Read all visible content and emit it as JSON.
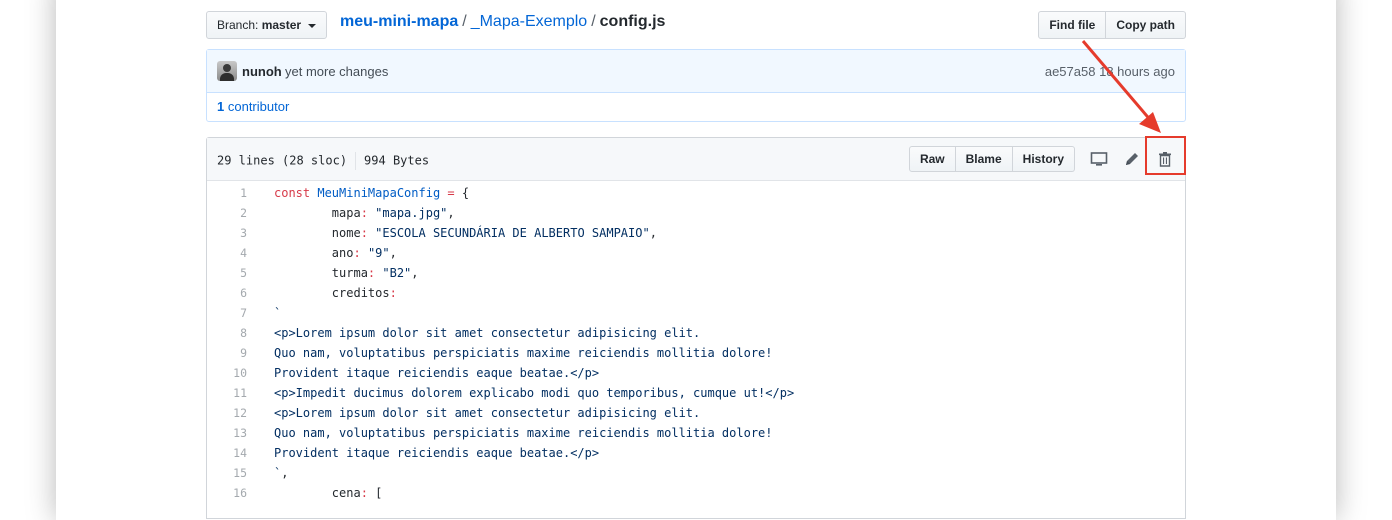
{
  "topbar": {
    "branch_prefix": "Branch:",
    "branch": "master",
    "repo": "meu-mini-mapa",
    "folder": "_Mapa-Exemplo",
    "file": "config.js",
    "find_file": "Find file",
    "copy_path": "Copy path"
  },
  "commit": {
    "author": "nunoh",
    "message": "yet more changes",
    "sha": "ae57a58",
    "time": "18 hours ago",
    "contributors_count": "1",
    "contributors_label": "contributor"
  },
  "file": {
    "lines": "29 lines (28 sloc)",
    "size": "994 Bytes",
    "raw": "Raw",
    "blame": "Blame",
    "history": "History"
  },
  "icons": {
    "desktop": "desktop-icon",
    "edit": "pencil-icon",
    "delete": "trash-icon"
  },
  "colors": {
    "link": "#0366d6",
    "highlight": "#e53b2c"
  },
  "code_lines": [
    {
      "n": "1",
      "parts": [
        [
          "kw",
          "const "
        ],
        [
          "nm",
          "MeuMiniMapaConfig"
        ],
        [
          "kw",
          " = "
        ],
        [
          "pl",
          "{"
        ]
      ]
    },
    {
      "n": "2",
      "parts": [
        [
          "pl",
          "        mapa"
        ],
        [
          "kw",
          ":"
        ],
        [
          "str",
          " \"mapa.jpg\""
        ],
        [
          "pl",
          ","
        ]
      ]
    },
    {
      "n": "3",
      "parts": [
        [
          "pl",
          "        nome"
        ],
        [
          "kw",
          ":"
        ],
        [
          "str",
          " \"ESCOLA SECUNDÁRIA DE ALBERTO SAMPAIO\""
        ],
        [
          "pl",
          ","
        ]
      ]
    },
    {
      "n": "4",
      "parts": [
        [
          "pl",
          "        ano"
        ],
        [
          "kw",
          ":"
        ],
        [
          "str",
          " \"9\""
        ],
        [
          "pl",
          ","
        ]
      ]
    },
    {
      "n": "5",
      "parts": [
        [
          "pl",
          "        turma"
        ],
        [
          "kw",
          ":"
        ],
        [
          "str",
          " \"B2\""
        ],
        [
          "pl",
          ","
        ]
      ]
    },
    {
      "n": "6",
      "parts": [
        [
          "pl",
          "        creditos"
        ],
        [
          "kw",
          ":"
        ]
      ]
    },
    {
      "n": "7",
      "parts": [
        [
          "str",
          "`"
        ]
      ]
    },
    {
      "n": "8",
      "parts": [
        [
          "str",
          "<p>Lorem ipsum dolor sit amet consectetur adipisicing elit."
        ]
      ]
    },
    {
      "n": "9",
      "parts": [
        [
          "str",
          "Quo nam, voluptatibus perspiciatis maxime reiciendis mollitia dolore!"
        ]
      ]
    },
    {
      "n": "10",
      "parts": [
        [
          "str",
          "Provident itaque reiciendis eaque beatae.</p>"
        ]
      ]
    },
    {
      "n": "11",
      "parts": [
        [
          "str",
          "<p>Impedit ducimus dolorem explicabo modi quo temporibus, cumque ut!</p>"
        ]
      ]
    },
    {
      "n": "12",
      "parts": [
        [
          "str",
          "<p>Lorem ipsum dolor sit amet consectetur adipisicing elit."
        ]
      ]
    },
    {
      "n": "13",
      "parts": [
        [
          "str",
          "Quo nam, voluptatibus perspiciatis maxime reiciendis mollitia dolore!"
        ]
      ]
    },
    {
      "n": "14",
      "parts": [
        [
          "str",
          "Provident itaque reiciendis eaque beatae.</p>"
        ]
      ]
    },
    {
      "n": "15",
      "parts": [
        [
          "str",
          "`"
        ],
        [
          "pl",
          ","
        ]
      ]
    },
    {
      "n": "16",
      "parts": [
        [
          "pl",
          "        cena"
        ],
        [
          "kw",
          ":"
        ],
        [
          "pl",
          " ["
        ]
      ]
    }
  ]
}
